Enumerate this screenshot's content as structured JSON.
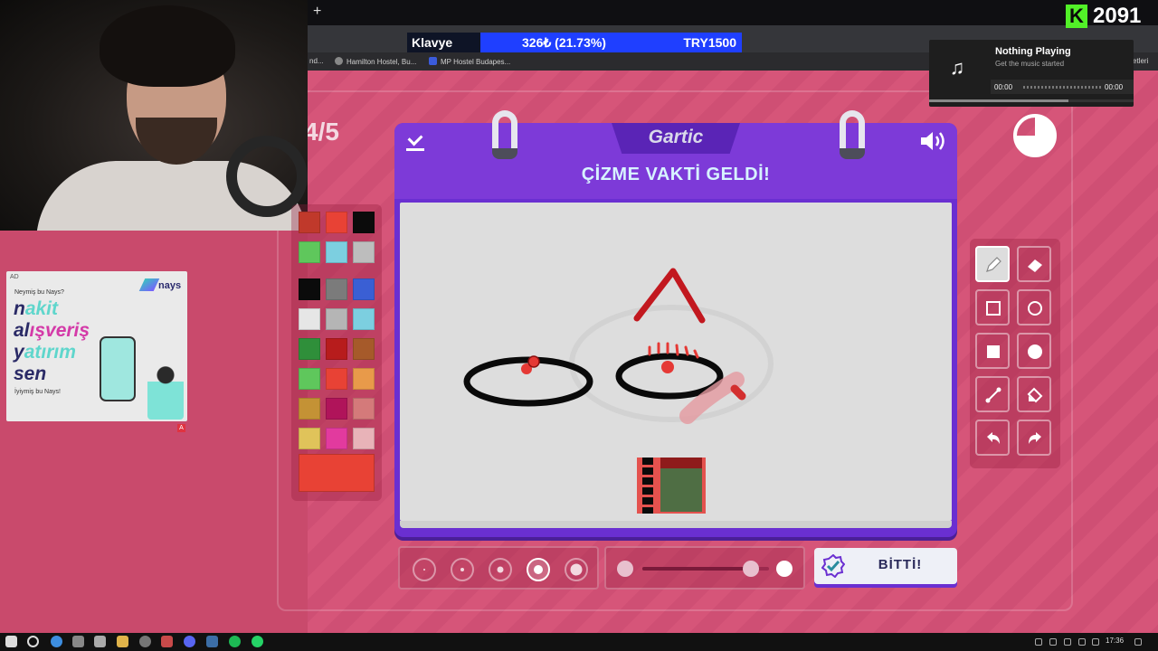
{
  "browser": {
    "new_tab_symbol": "+",
    "bookmarks": [
      {
        "label": "nd..."
      },
      {
        "label": "Hamilton Hostel, Bu..."
      },
      {
        "label": "MP Hostel Budapes..."
      }
    ],
    "right_fragment": "etleri"
  },
  "donation": {
    "label": "Klavye",
    "amount": "326₺ (21.73%)",
    "goal": "TRY1500",
    "progress_percent": 21.73
  },
  "counter": {
    "letter": "K",
    "value": "2091",
    "color": "#52f028"
  },
  "music": {
    "title": "Nothing Playing",
    "subtitle": "Get the music started",
    "time_start": "00:00",
    "time_end": "00:00",
    "icon": "music-note-icon"
  },
  "ad": {
    "tag": "AD",
    "brand": "nays",
    "question": "Neymiş bu Nays?",
    "words": [
      {
        "first": "n",
        "rest": "akit"
      },
      {
        "first": "al",
        "rest": "ışveriş"
      },
      {
        "first": "y",
        "rest": "atırım"
      },
      {
        "first": "sen",
        "rest": ""
      }
    ],
    "bottom": "İyiymiş bu Nays!",
    "badge": "A"
  },
  "game": {
    "round": "4/5",
    "logo": "Gartic",
    "title": "ÇİZME VAKTİ GELDİ!",
    "done_label": "BİTTİ!",
    "timer_remaining_fraction": 0.75,
    "selected_brush_size_index": 3,
    "opacity_fraction": 0.86,
    "active_tool": "pencil",
    "current_color": "#e84235",
    "palette": [
      "#c0392b",
      "#e84235",
      "#0b0b0b",
      "#5fc75c",
      "#7ccfe0",
      "#bdbdbd",
      "#0b0b0b",
      "#7b7b7b",
      "#3a5fd4",
      "#e6e6e6",
      "#b5b5b5",
      "#7ccfe0",
      "#2f8f3a",
      "#b71c1c",
      "#a65a2a",
      "#5fc75c",
      "#e84235",
      "#e89a4a",
      "#c49235",
      "#b0145a",
      "#d47a7a",
      "#e0c35a",
      "#e23a9e",
      "#e8b3b8"
    ],
    "tools": [
      "pencil-icon",
      "eraser-icon",
      "rectangle-outline-icon",
      "circle-outline-icon",
      "rectangle-fill-icon",
      "circle-fill-icon",
      "line-icon",
      "fill-bucket-icon",
      "undo-icon",
      "redo-icon"
    ]
  },
  "taskbar": {
    "clock": "17:36"
  }
}
